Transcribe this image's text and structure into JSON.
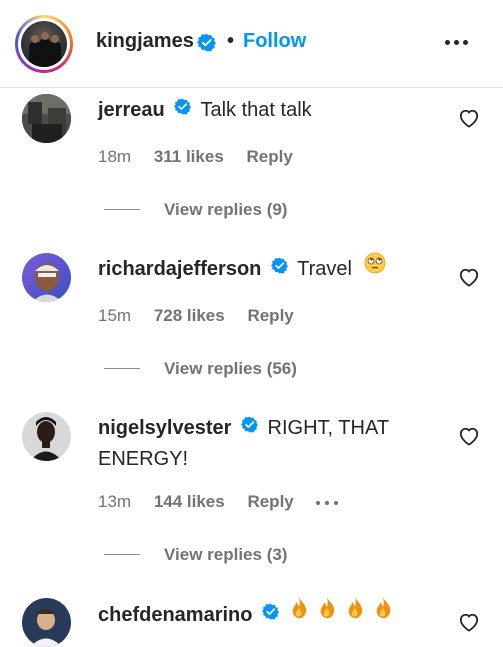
{
  "header": {
    "username": "kingjames",
    "separator": "•",
    "follow_label": "Follow"
  },
  "comments": [
    {
      "username": "jerreau",
      "text": "Talk that talk",
      "time": "18m",
      "likes": "311 likes",
      "reply_label": "Reply",
      "view_replies": "View replies (9)"
    },
    {
      "username": "richardajefferson",
      "text": "Travel",
      "emoji": "face-with-rolling-eyes",
      "time": "15m",
      "likes": "728 likes",
      "reply_label": "Reply",
      "view_replies": "View replies (56)"
    },
    {
      "username": "nigelsylvester",
      "text_line1": "RIGHT, THAT",
      "text_line2": "ENERGY!",
      "time": "13m",
      "likes": "144 likes",
      "reply_label": "Reply",
      "view_replies": "View replies (3)"
    },
    {
      "username": "chefdenamarino",
      "emoji": "fire x4"
    }
  ],
  "colors": {
    "link_blue": "#0095f6",
    "verified_blue": "#0095f6",
    "secondary_text": "#737373",
    "primary_text": "#262626"
  }
}
